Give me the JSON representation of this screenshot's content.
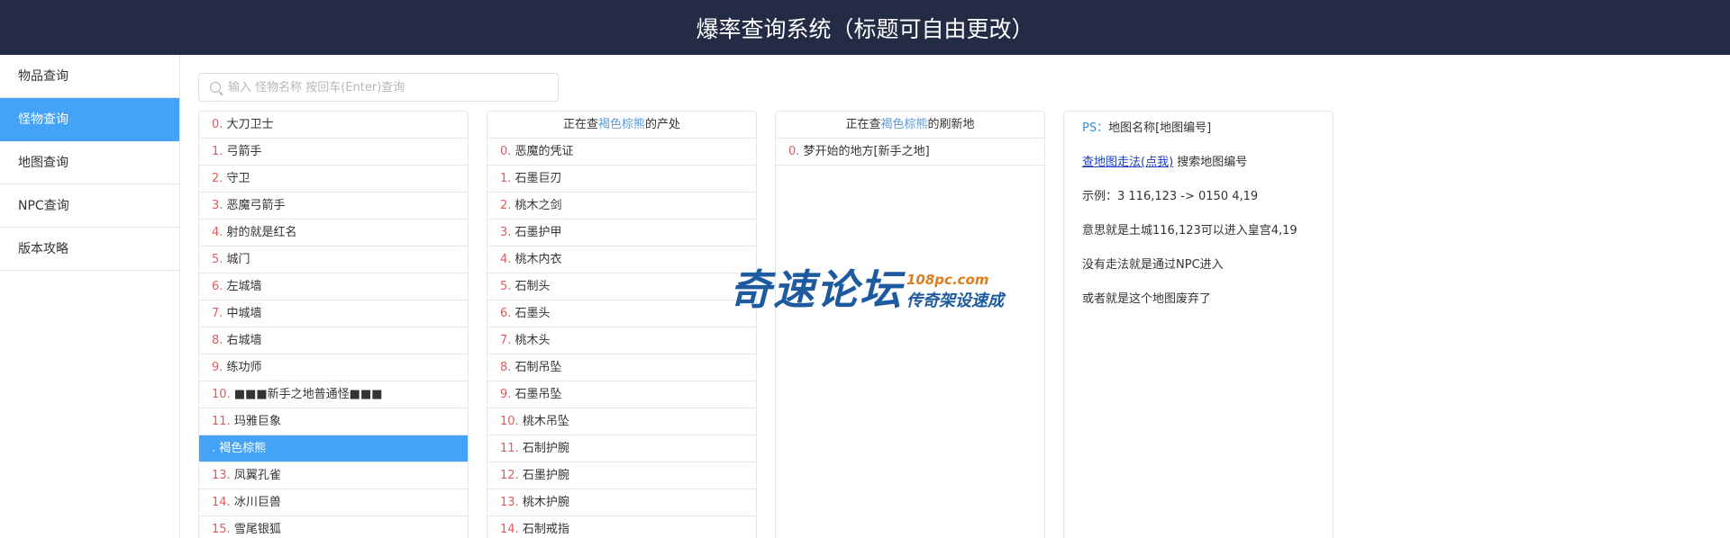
{
  "header": {
    "title": "爆率查询系统（标题可自由更改）"
  },
  "sidebar": {
    "items": [
      {
        "label": "物品查询",
        "active": false
      },
      {
        "label": "怪物查询",
        "active": true
      },
      {
        "label": "地图查询",
        "active": false
      },
      {
        "label": "NPC查询",
        "active": false
      },
      {
        "label": "版本攻略",
        "active": false
      }
    ]
  },
  "search": {
    "placeholder": "输入 怪物名称 按回车(Enter)查询",
    "value": ""
  },
  "monsters": {
    "selected_index": 12,
    "items": [
      {
        "idx": "0.",
        "name": "大刀卫士"
      },
      {
        "idx": "1.",
        "name": "弓箭手"
      },
      {
        "idx": "2.",
        "name": "守卫"
      },
      {
        "idx": "3.",
        "name": "恶魔弓箭手"
      },
      {
        "idx": "4.",
        "name": "射的就是红名"
      },
      {
        "idx": "5.",
        "name": "城门"
      },
      {
        "idx": "6.",
        "name": "左城墙"
      },
      {
        "idx": "7.",
        "name": "中城墙"
      },
      {
        "idx": "8.",
        "name": "右城墙"
      },
      {
        "idx": "9.",
        "name": "练功师"
      },
      {
        "idx": "10.",
        "name": "■■■新手之地普通怪■■■"
      },
      {
        "idx": "11.",
        "name": "玛雅巨象"
      },
      {
        "idx": ".",
        "name": "褐色棕熊"
      },
      {
        "idx": "13.",
        "name": "凤翼孔雀"
      },
      {
        "idx": "14.",
        "name": "冰川巨兽"
      },
      {
        "idx": "15.",
        "name": "雪尾银狐"
      }
    ]
  },
  "drops": {
    "head_prefix": "正在查",
    "head_name": "褐色棕熊",
    "head_suffix": "的产处",
    "items": [
      {
        "idx": "0.",
        "name": "恶魔的凭证"
      },
      {
        "idx": "1.",
        "name": "石墨巨刃"
      },
      {
        "idx": "2.",
        "name": "桃木之剑"
      },
      {
        "idx": "3.",
        "name": "石墨护甲"
      },
      {
        "idx": "4.",
        "name": "桃木内衣"
      },
      {
        "idx": "5.",
        "name": "石制头"
      },
      {
        "idx": "6.",
        "name": "石墨头"
      },
      {
        "idx": "7.",
        "name": "桃木头"
      },
      {
        "idx": "8.",
        "name": "石制吊坠"
      },
      {
        "idx": "9.",
        "name": "石墨吊坠"
      },
      {
        "idx": "10.",
        "name": "桃木吊坠"
      },
      {
        "idx": "11.",
        "name": "石制护腕"
      },
      {
        "idx": "12.",
        "name": "石墨护腕"
      },
      {
        "idx": "13.",
        "name": "桃木护腕"
      },
      {
        "idx": "14.",
        "name": "石制戒指"
      }
    ]
  },
  "spawns": {
    "head_prefix": "正在查",
    "head_name": "褐色棕熊",
    "head_suffix": "的刷新地",
    "items": [
      {
        "idx": "0.",
        "name": "梦开始的地方[新手之地]"
      }
    ]
  },
  "info": {
    "ps_label": "PS：",
    "ps_text": "地图名称[地图编号]",
    "link_text": "查地图走法(点我)",
    "link_suffix": " 搜索地图编号",
    "lines": [
      "示例：3 116,123 -> 0150 4,19",
      "意思就是土城116,123可以进入皇宫4,19",
      "没有走法就是通过NPC进入",
      "或者就是这个地图废弃了"
    ]
  },
  "watermark": {
    "main": "奇速论坛",
    "url": "108pc.com",
    "sub": "传奇架设速成"
  },
  "colors": {
    "header_bg": "#232b45",
    "accent": "#44a3f6",
    "index": "#e05c5c",
    "highlight": "#5b9bd5"
  }
}
